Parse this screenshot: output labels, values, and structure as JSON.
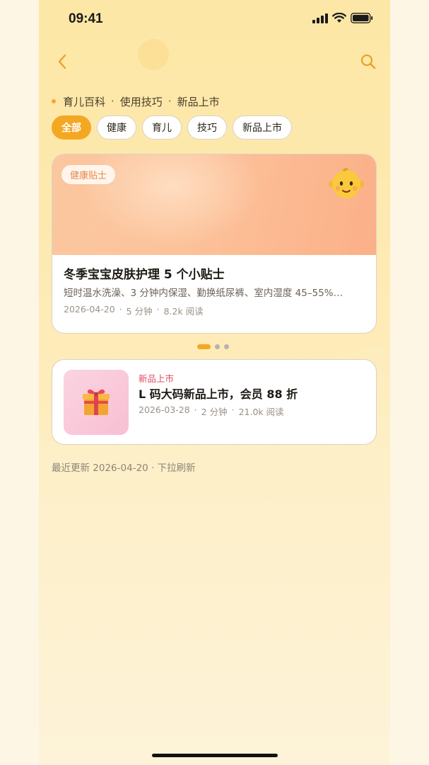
{
  "status_bar": {
    "time": "09:41",
    "icons": [
      "signal-icon",
      "wifi-icon",
      "battery-icon"
    ]
  },
  "nav": {
    "back_icon": "chevron-left-icon",
    "search_icon": "search-icon"
  },
  "breadcrumb": {
    "items": [
      "育儿百科",
      "使用技巧",
      "新品上市"
    ],
    "separator": "·"
  },
  "chips": [
    {
      "label": "全部",
      "active": true
    },
    {
      "label": "健康",
      "active": false
    },
    {
      "label": "育儿",
      "active": false
    },
    {
      "label": "技巧",
      "active": false
    },
    {
      "label": "新品上市",
      "active": false
    }
  ],
  "featured": {
    "tag": "健康贴士",
    "icon": "baby-face-icon",
    "title": "冬季宝宝皮肤护理 5 个小贴士",
    "description": "短时温水洗澡、3 分钟内保湿、勤换纸尿裤、室内湿度 45–55%…",
    "date": "2026-04-20",
    "read_time": "5 分钟",
    "views": "8.2k 阅读"
  },
  "carousel": {
    "count": 3,
    "active_index": 0
  },
  "articles": [
    {
      "tag": "新品上市",
      "icon": "gift-icon",
      "title": "L 码大码新品上市，会员 88 折",
      "date": "2026-03-28",
      "read_time": "2 分钟",
      "views": "21.0k 阅读"
    }
  ],
  "footer": {
    "updated_text": "最近更新 2026-04-20 · 下拉刷新"
  },
  "colors": {
    "accent": "#f4a822",
    "tag_pink": "#e2475f",
    "tag_orange": "#e78a4a",
    "background": "#fde9af"
  }
}
